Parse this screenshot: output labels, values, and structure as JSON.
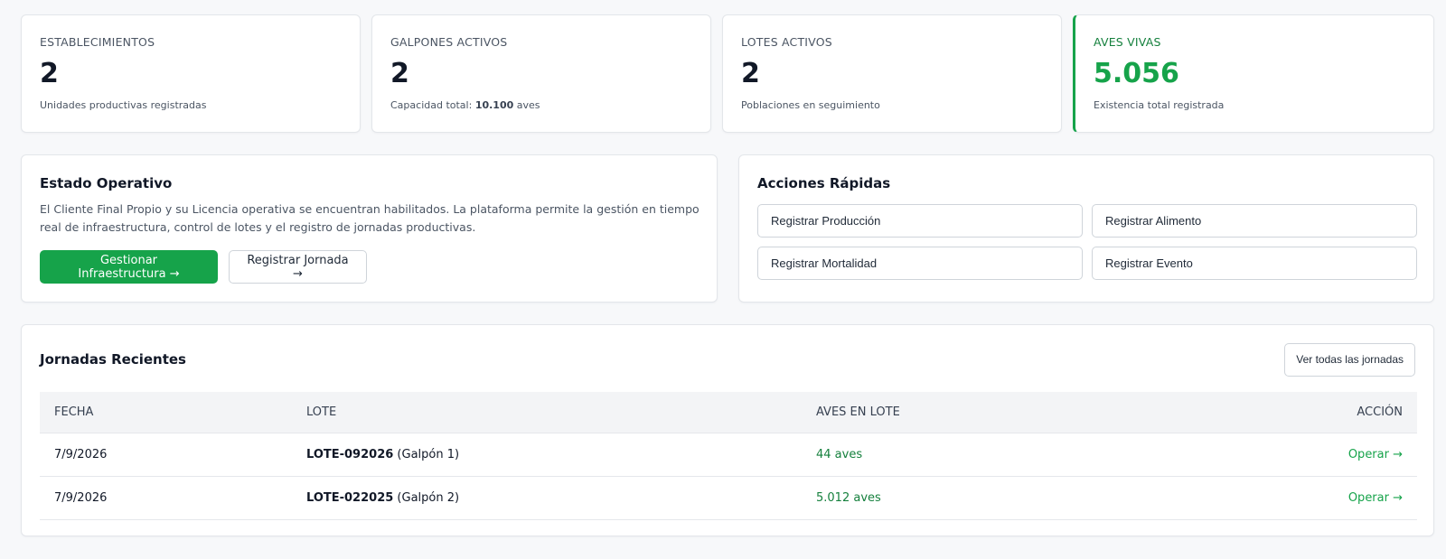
{
  "stats": [
    {
      "label": "ESTABLECIMIENTOS",
      "value": "2",
      "sub": "Unidades productivas registradas"
    },
    {
      "label": "GALPONES ACTIVOS",
      "value": "2",
      "sub_prefix": "Capacidad total: ",
      "sub_bold": "10.100",
      "sub_suffix": " aves"
    },
    {
      "label": "LOTES ACTIVOS",
      "value": "2",
      "sub": "Poblaciones en seguimiento"
    },
    {
      "label": "AVES VIVAS",
      "value": "5.056",
      "sub": "Existencia total registrada"
    }
  ],
  "estado": {
    "title": "Estado Operativo",
    "text": "El Cliente Final Propio y su Licencia operativa se encuentran habilitados. La plataforma permite la gestión en tiempo real de infraestructura, control de lotes y el registro de jornadas productivas.",
    "primary_button": "Gestionar Infraestructura →",
    "secondary_button": "Registrar Jornada →"
  },
  "acciones": {
    "title": "Acciones Rápidas",
    "items": [
      "Registrar Producción",
      "Registrar Alimento",
      "Registrar Mortalidad",
      "Registrar Evento"
    ]
  },
  "jornadas": {
    "title": "Jornadas Recientes",
    "view_all": "Ver todas las jornadas",
    "columns": [
      "FECHA",
      "LOTE",
      "AVES EN LOTE",
      "ACCIÓN"
    ],
    "rows": [
      {
        "fecha": "7/9/2026",
        "lote": "LOTE-092026",
        "galpon": " (Galpón 1)",
        "aves": "44 aves",
        "accion": "Operar →"
      },
      {
        "fecha": "7/9/2026",
        "lote": "LOTE-022025",
        "galpon": " (Galpón 2)",
        "aves": "5.012 aves",
        "accion": "Operar →"
      }
    ]
  },
  "colors": {
    "accent": "#16a34a",
    "background": "#f7f8fa",
    "border": "#e3e6ea"
  }
}
